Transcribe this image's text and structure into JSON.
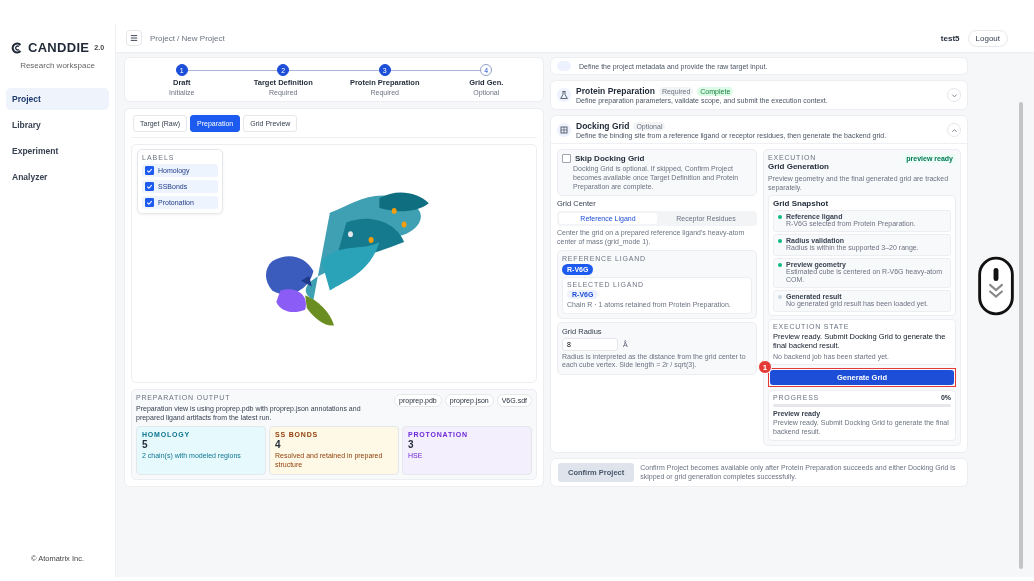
{
  "sidebar": {
    "brand": "CANDDIE",
    "version": "2.0",
    "subtitle": "Research workspace",
    "items": [
      {
        "label": "Project",
        "selected": true
      },
      {
        "label": "Library",
        "selected": false
      },
      {
        "label": "Experiment",
        "selected": false
      },
      {
        "label": "Analyzer",
        "selected": false
      }
    ],
    "footer": "© Atomatrix Inc."
  },
  "header": {
    "breadcrumb": "Project / New Project",
    "user": "test5",
    "logout": "Logout"
  },
  "stepper": [
    {
      "number": "1",
      "label": "Draft",
      "sub": "Initialize",
      "done": true
    },
    {
      "number": "2",
      "label": "Target Definition",
      "sub": "Required",
      "done": true
    },
    {
      "number": "3",
      "label": "Protein Preparation",
      "sub": "Required",
      "done": true
    },
    {
      "number": "4",
      "label": "Grid Gen.",
      "sub": "Optional",
      "done": false
    }
  ],
  "view_tabs": [
    {
      "label": "Target (Raw)",
      "selected": false
    },
    {
      "label": "Preparation",
      "selected": true
    },
    {
      "label": "Grid Preview",
      "selected": false
    }
  ],
  "labels_panel": {
    "title": "LABELS",
    "items": [
      {
        "label": "Homology",
        "checked": true
      },
      {
        "label": "SSBonds",
        "checked": true
      },
      {
        "label": "Protonation",
        "checked": true
      }
    ]
  },
  "preparation_output": {
    "title": "PREPARATION OUTPUT",
    "description": "Preparation view is using proprep.pdb with proprep.json annotations and prepared ligand artifacts from the latest run.",
    "files": [
      "proprep.pdb",
      "proprep.json",
      "V6G.sdf"
    ],
    "stats": [
      {
        "title": "HOMOLOGY",
        "value": "5",
        "note": "2 chain(s) with modeled regions",
        "color": "#e6fafd"
      },
      {
        "title": "SS BONDS",
        "value": "4",
        "note": "Resolved and retained in prepared structure",
        "color": "#fdf9e6"
      },
      {
        "title": "PROTONATION",
        "value": "3",
        "note": "HSE",
        "color": "#f3effc"
      }
    ]
  },
  "project_card": {
    "description": "Define the project metadata and provide the raw target input."
  },
  "protein_preparation": {
    "title": "Protein Preparation",
    "badges": [
      "Required",
      "Complete"
    ],
    "description": "Define preparation parameters, validate scope, and submit the execution context.",
    "expanded": false
  },
  "docking_grid": {
    "title": "Docking Grid",
    "badge": "Optional",
    "description": "Define the binding site from a reference ligand or receptor residues, then generate the backend grid.",
    "expanded": true,
    "skip": {
      "label": "Skip Docking Grid",
      "checked": false,
      "note": "Docking Grid is optional. If skipped, Confirm Project becomes available once Target Definition and Protein Preparation are complete."
    },
    "grid_center": {
      "title": "Grid Center",
      "options": [
        {
          "label": "Reference Ligand",
          "selected": true
        },
        {
          "label": "Receptor Residues",
          "selected": false
        }
      ],
      "note": "Center the grid on a prepared reference ligand's heavy-atom center of mass (grid_mode 1)."
    },
    "reference_ligand": {
      "title": "REFERENCE LIGAND",
      "chips": [
        {
          "label": "R-V6G",
          "selected": true
        }
      ],
      "selected_title": "SELECTED LIGAND",
      "selected_chip": "R-V6G",
      "selected_note": "Chain R · 1 atoms retained from Protein Preparation."
    },
    "grid_radius": {
      "title": "Grid Radius",
      "value": "8",
      "unit": "Å",
      "note": "Radius is interpreted as the distance from the grid center to each cube vertex. Side length = 2r / sqrt(3)."
    },
    "execution": {
      "eyebrow": "EXECUTION",
      "title": "Grid Generation",
      "badge": "preview ready",
      "description": "Preview geometry and the final generated grid are tracked separately.",
      "snapshot_title": "Grid Snapshot",
      "snapshot": [
        {
          "title": "Reference ligand",
          "note": "R-V6G selected from Protein Preparation.",
          "color": "#10b981"
        },
        {
          "title": "Radius validation",
          "note": "Radius is within the supported 3–20 range.",
          "color": "#10b981"
        },
        {
          "title": "Preview geometry",
          "note": "Estimated cube is centered on R-V6G heavy-atom COM.",
          "color": "#10b981"
        },
        {
          "title": "Generated result",
          "note": "No generated grid result has been loaded yet.",
          "color": "#cbd5e1"
        }
      ],
      "state_title": "EXECUTION STATE",
      "state_text": "Preview ready. Submit Docking Grid to generate the final backend result.",
      "state_note": "No backend job has been started yet.",
      "button": "Generate Grid",
      "button_highlighted": true,
      "marker": "1",
      "progress_title": "PROGRESS",
      "progress_value": "0%",
      "level": 0,
      "progress_status": "Preview ready",
      "progress_note": "Preview ready. Submit Docking Grid to generate the final backend result."
    }
  },
  "confirm": {
    "button": "Confirm Project",
    "disabled": true,
    "note": "Confirm Project becomes available only after Protein Preparation succeeds and either Docking Grid is skipped or grid generation completes successfully."
  }
}
